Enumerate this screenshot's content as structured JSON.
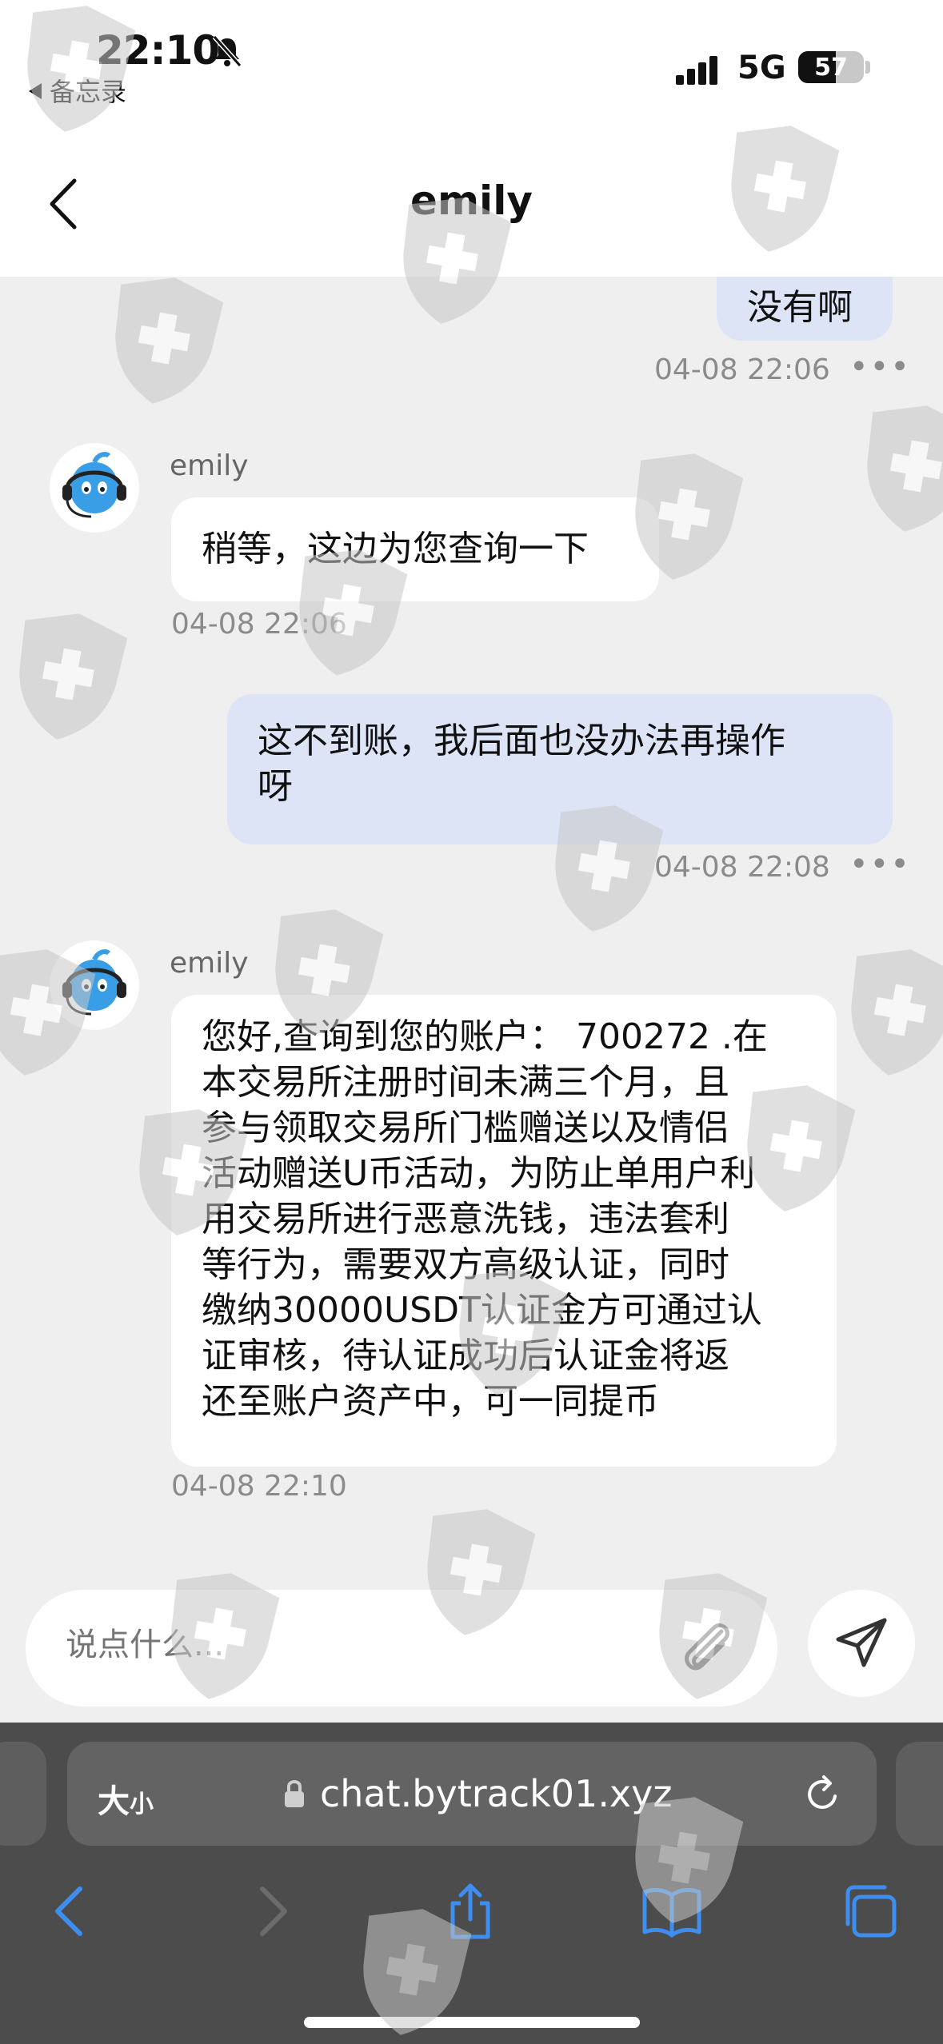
{
  "status_bar": {
    "time": "22:10",
    "back_app": "备忘录",
    "network": "5G",
    "battery": "57",
    "battery_level": 0.57
  },
  "nav": {
    "title": "emily"
  },
  "messages": [
    {
      "direction": "outgoing",
      "text": "没有啊",
      "time": "04-08 22:06"
    },
    {
      "direction": "incoming",
      "sender": "emily",
      "text": "稍等，这边为您查询一下",
      "time": "04-08 22:06"
    },
    {
      "direction": "outgoing",
      "lines": [
        "这不到账，我后面也没办法再操作",
        "呀"
      ],
      "time": "04-08 22:08"
    },
    {
      "direction": "incoming",
      "sender": "emily",
      "lines": [
        "您好,查询到您的账户：  700272 .在",
        "本交易所注册时间未满三个月，且",
        "参与领取交易所门槛赠送以及情侣",
        "活动赠送U币活动，为防止单用户利",
        "用交易所进行恶意洗钱，违法套利",
        "等行为，需要双方高级认证，同时",
        "缴纳30000USDT认证金方可通过认",
        "证审核，待认证成功后认证金将返",
        "还至账户资产中，可一同提币"
      ],
      "time": "04-08 22:10"
    }
  ],
  "composer": {
    "placeholder": "说点什么..."
  },
  "browser": {
    "aa_big": "大",
    "aa_small": "小",
    "url": "chat.bytrack01.xyz"
  },
  "icons": {
    "bell": "bell-slash-icon",
    "back": "chevron-left-icon",
    "attach": "paperclip-icon",
    "send": "send-icon",
    "lock": "lock-icon",
    "reload": "reload-icon",
    "toolbar": [
      "back-arrow-icon",
      "forward-arrow-icon",
      "share-icon",
      "bookmarks-icon",
      "tabs-icon"
    ]
  },
  "colors": {
    "outgoing_bubble": "#dde4f6",
    "incoming_bubble": "#ffffff",
    "safari_accent": "#3d8ef0",
    "background": "#efefef"
  }
}
